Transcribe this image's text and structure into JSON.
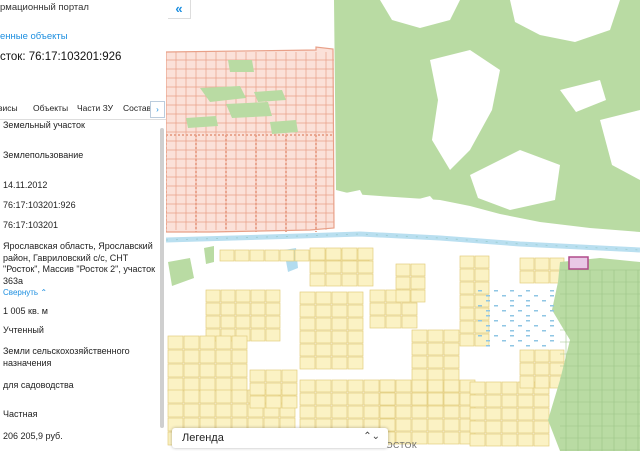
{
  "panel": {
    "portal_title": "рмационный портал",
    "selected_objects": "енные объекты",
    "parcel_title": "сток: 76:17:103201:926",
    "tabs": [
      "висы",
      "Объекты",
      "Части ЗУ",
      "Состав"
    ],
    "tab_more": "›",
    "fields": [
      "Земельный участок",
      "Землепользование",
      "14.11.2012",
      "76:17:103201:926",
      "76:17:103201",
      "Ярославская область, Ярославский район, Гавриловский с/с, СНТ \"Росток\", Массив \"Росток 2\", участок 363а",
      "1 005 кв. м",
      "Учтенный",
      "Земли сельскохозяйственного назначения",
      "для садоводства",
      "Частная",
      "206 205,9 руб."
    ],
    "collapse_link": "Свернуть",
    "collapse_icon": "chevron-up-icon"
  },
  "map": {
    "collapse_button": "«",
    "place_label": "РОСТОК",
    "legend_label": "Легенда",
    "legend_icon": "chevron-updown-icon",
    "colors": {
      "background": "#ffffff",
      "forest": "#b9dba3",
      "forest_dark": "#a7cf8f",
      "water": "#b3dcef",
      "parcel_fill": "#fbf2c4",
      "parcel_stroke": "#e3cd7e",
      "cadastral_fill": "#fbe1d9",
      "cadastral_stroke": "#e8a088",
      "selected_parcel": "#b04a8a",
      "road": "#b9dff0"
    }
  }
}
